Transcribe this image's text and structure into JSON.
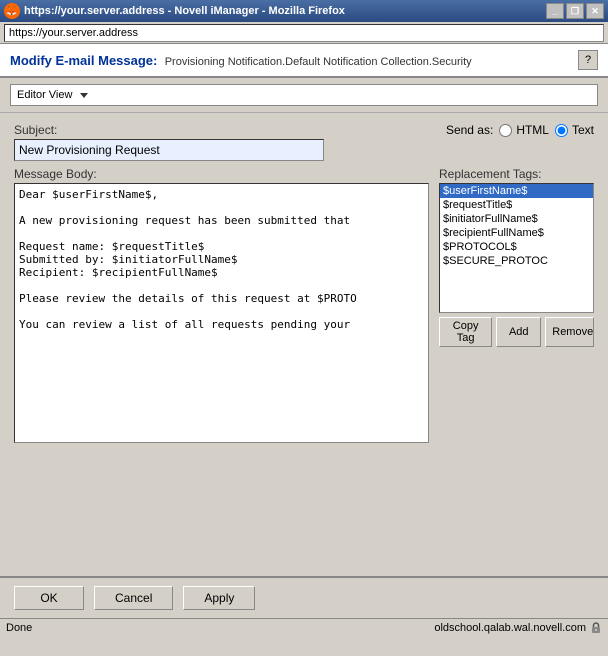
{
  "window": {
    "title": "https://your.server.address          - Novell iManager - Mozilla Firefox",
    "address": "https://your.server.address",
    "status_text": "Done",
    "status_url": "oldschool.qalab.wal.novell.com"
  },
  "header": {
    "title": "Modify E-mail Message:",
    "breadcrumb": "Provisioning Notification.Default Notification Collection.Security",
    "help_label": "?"
  },
  "toolbar": {
    "dropdown_label": "Editor View"
  },
  "form": {
    "subject_label": "Subject:",
    "subject_value": "New Provisioning Request",
    "message_body_label": "Message Body:",
    "send_as_label": "Send as:",
    "send_as_html": "HTML",
    "send_as_text": "Text",
    "replacement_tags_label": "Replacement Tags:",
    "message_body_text": "Dear $userFirstName$,\n\nA new provisioning request has been submitted that\n\nRequest name: $requestTitle$\nSubmitted by: $initiatorFullName$\nRecipient: $recipientFullName$\n\nPlease review the details of this request at $PROTO\n\nYou can review a list of all requests pending your"
  },
  "replacement_tags": {
    "items": [
      "$userFirstName$",
      "$requestTitle$",
      "$initiatorFullName$",
      "$recipientFullName$",
      "$PROTOCOL$",
      "$SECURE_PROTOC"
    ],
    "copy_tag_label": "Copy Tag",
    "add_label": "Add",
    "remove_label": "Remove"
  },
  "buttons": {
    "ok_label": "OK",
    "cancel_label": "Cancel",
    "apply_label": "Apply"
  },
  "title_buttons": {
    "minimize": "_",
    "restore": "❐",
    "close": "✕"
  }
}
